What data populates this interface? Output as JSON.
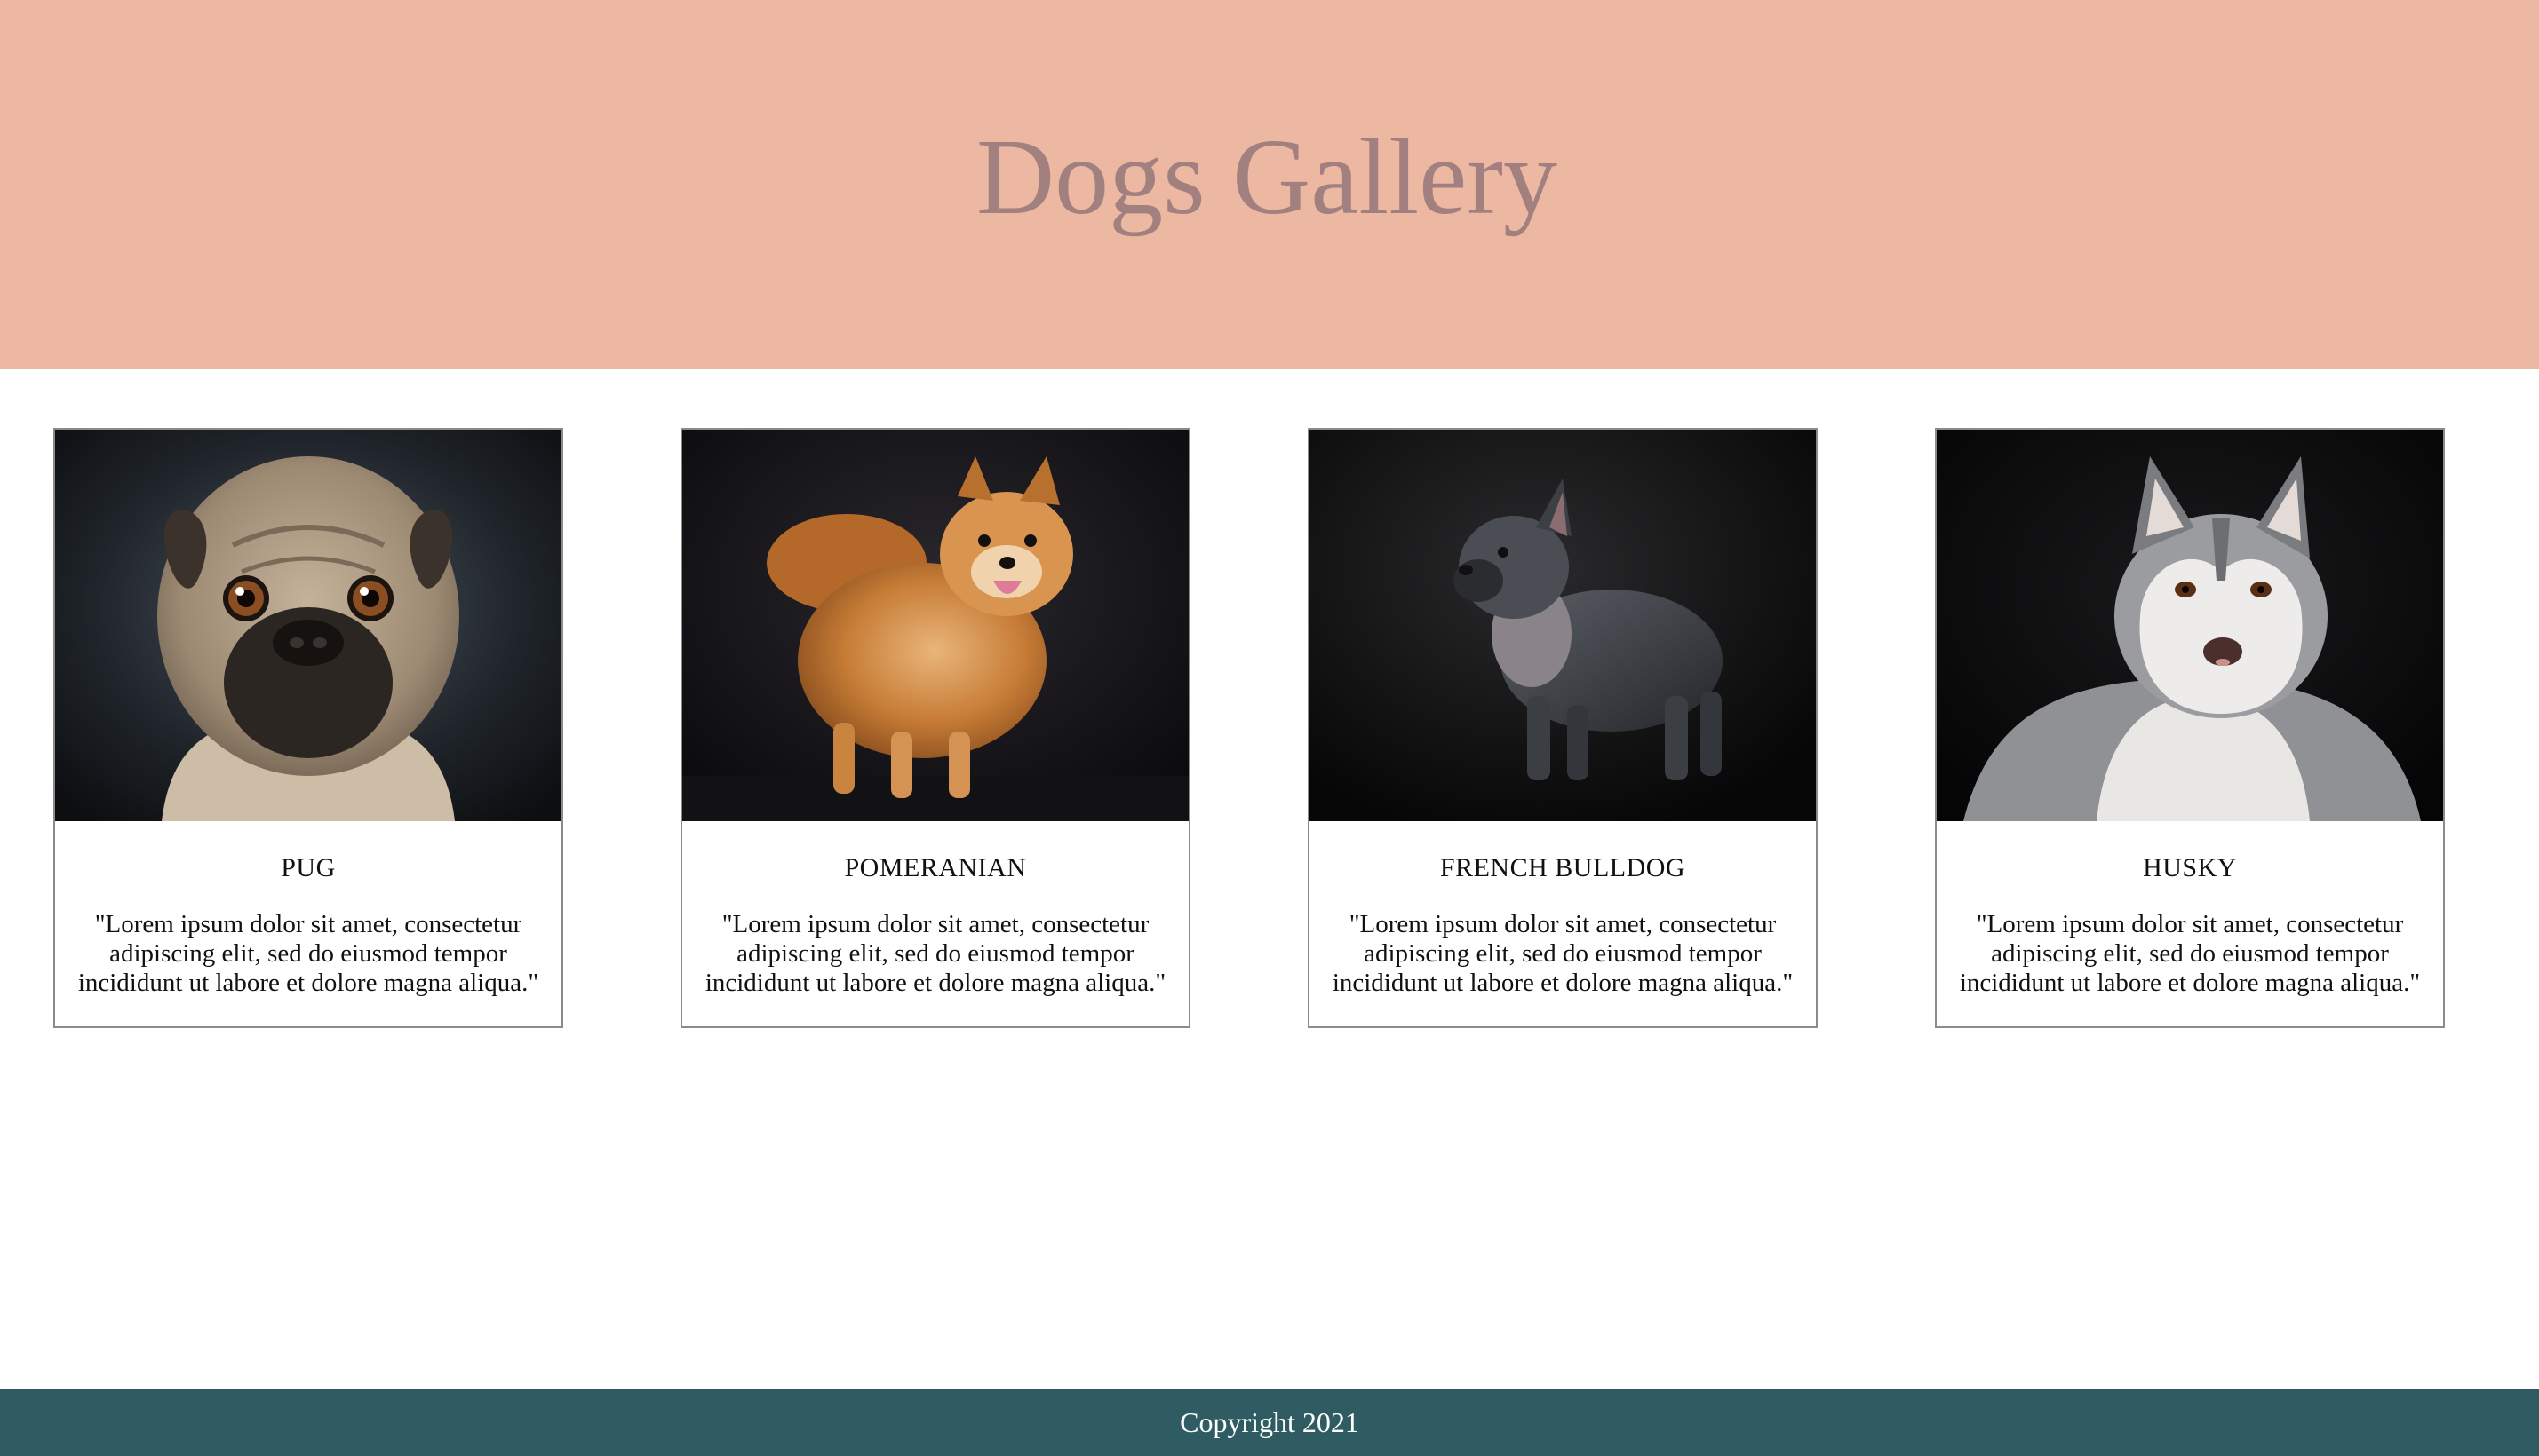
{
  "header": {
    "title": "Dogs Gallery"
  },
  "colors": {
    "header_bg": "#ecb8a1",
    "title_color": "#a28080",
    "footer_bg": "#2f5b62"
  },
  "cards": [
    {
      "name": "PUG",
      "description": "\"Lorem ipsum dolor sit amet, consectetur adipiscing elit, sed do eiusmod tempor incididunt ut labore et dolore magna aliqua.\"",
      "image": "pug-photo"
    },
    {
      "name": "POMERANIAN",
      "description": "\"Lorem ipsum dolor sit amet, consectetur adipiscing elit, sed do eiusmod tempor incididunt ut labore et dolore magna aliqua.\"",
      "image": "pomeranian-photo"
    },
    {
      "name": "FRENCH BULLDOG",
      "description": "\"Lorem ipsum dolor sit amet, consectetur adipiscing elit, sed do eiusmod tempor incididunt ut labore et dolore magna aliqua.\"",
      "image": "french-bulldog-photo"
    },
    {
      "name": "HUSKY",
      "description": "\"Lorem ipsum dolor sit amet, consectetur adipiscing elit, sed do eiusmod tempor incididunt ut labore et dolore magna aliqua.\"",
      "image": "husky-photo"
    }
  ],
  "footer": {
    "copyright": "Copyright 2021"
  }
}
